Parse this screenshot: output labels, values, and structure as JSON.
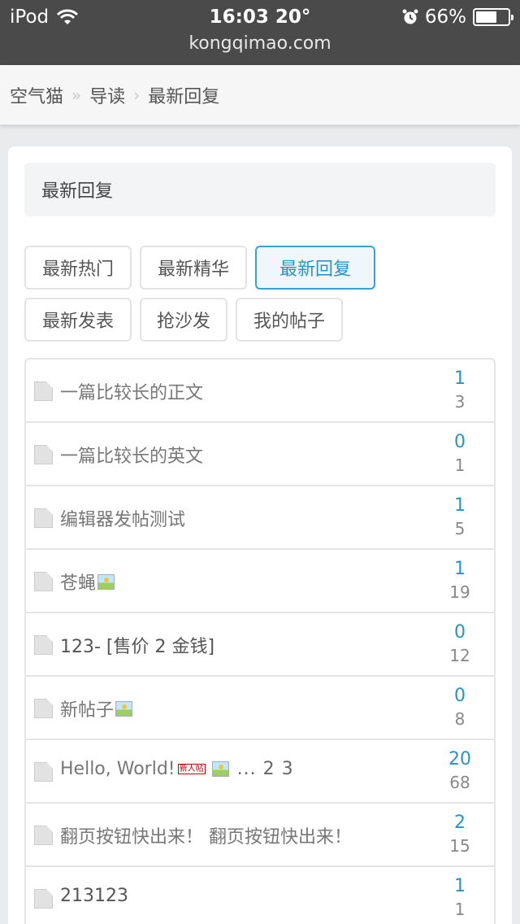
{
  "status_bar": {
    "device": "iPod",
    "time": "16:03 20°",
    "battery": "66%",
    "battery_level": 0.66,
    "url": "kongqimao.com"
  },
  "breadcrumb": {
    "items": [
      "空气猫",
      "导读",
      "最新回复"
    ],
    "separators": [
      "»",
      "›"
    ]
  },
  "section_title": "最新回复",
  "tabs": [
    {
      "label": "最新热门",
      "active": false
    },
    {
      "label": "最新精华",
      "active": false
    },
    {
      "label": "最新回复",
      "active": true
    },
    {
      "label": "最新发表",
      "active": false
    },
    {
      "label": "抢沙发",
      "active": false
    },
    {
      "label": "我的帖子",
      "active": false
    }
  ],
  "threads": [
    {
      "title": "一篇比较长的正文",
      "replies": "1",
      "views": "3"
    },
    {
      "title": "一篇比较长的英文",
      "replies": "0",
      "views": "1"
    },
    {
      "title": "编辑器发帖测试",
      "replies": "1",
      "views": "5"
    },
    {
      "title": "苍蝇",
      "replies": "1",
      "views": "19",
      "image_icon": "image-icon"
    },
    {
      "title": "123- [售价 2 金钱]",
      "replies": "0",
      "views": "12"
    },
    {
      "title": "新帖子",
      "replies": "0",
      "views": "8",
      "image_icon": "image-icon"
    },
    {
      "title": "Hello, World!",
      "badge": "新人帖",
      "pages": "... 2 3",
      "replies": "20",
      "views": "68",
      "image_icon": "image-icon"
    },
    {
      "title": "翻页按钮快出来！ 翻页按钮快出来！",
      "replies": "2",
      "views": "15"
    },
    {
      "title": "213123",
      "replies": "1",
      "views": "1"
    }
  ],
  "colors": {
    "accent": "#2a93c6",
    "status_bar_bg": "#4a4a4a",
    "page_bg": "#e9ebec"
  }
}
